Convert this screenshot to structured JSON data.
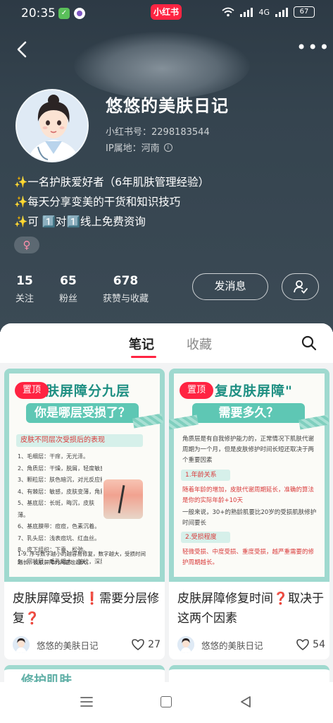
{
  "status_bar": {
    "time": "20:35",
    "app_badge": "小红书",
    "network": "4G",
    "battery": "67"
  },
  "profile": {
    "nickname": "悠悠的美肤日记",
    "id_label": "小红书号：2298183544",
    "ip_label": "IP属地：河南",
    "bio": [
      "✨一名护肤爱好者（6年肌肤管理经验）",
      "✨每天分享变美的干货和知识技巧",
      "✨可 1️⃣对1️⃣线上免费资询"
    ],
    "gender": "♀"
  },
  "stats": [
    {
      "num": "15",
      "label": "关注"
    },
    {
      "num": "65",
      "label": "粉丝"
    },
    {
      "num": "678",
      "label": "获赞与收藏"
    }
  ],
  "actions": {
    "message": "发消息"
  },
  "tabs": {
    "notes": "笔记",
    "collections": "收藏"
  },
  "cards": [
    {
      "pin": "置顶",
      "cover_title": "肤屏障分九层",
      "cover_banner": "你是哪层受损了？",
      "cover_sub": "皮肤不同层次受损后的表现",
      "cover_list": [
        "1、毛细层：干痒，无光泽。",
        "2、角质层：干燥，脱屑，轻度敏感，有紧绷感。",
        "3、颗粒层：肤色暗沉，对光反应能力下降。",
        "4、有棘层：敏感，皮肤变薄，角质层变薄。",
        "5、基底层：长斑，晦沉，皮肤薄。",
        "6、基底膜带：痘痘，色素沉着。",
        "7、乳头层：浅表痘坑、红血丝。",
        "8、皮下组织：下垂、松弛。",
        "9、网状层：毛孔粗大，皱纹，深层痘坑。"
      ],
      "cover_foot": "1-9. 序号数字越小的越容易修复，数字越大，受损时间越长，皮肤屏障的问题也越大。",
      "title": "皮肤屏障受损❗需要分层修复❓",
      "author": "悠悠的美肤日记",
      "likes": "27"
    },
    {
      "pin": "置顶",
      "cover_title": "复皮肤屏障\"",
      "cover_banner": "需要多久？",
      "cover_para": "角质层是有自我修护能力的，正常情况下肌肤代谢周期为一个月，但是皮肤修护时间长短还取决于两个重要因素",
      "tag1": "1.年龄关系",
      "red1": "随着年龄的增加，皮肤代谢周期延长，准确的算法是你的实际年龄+10天",
      "black1": "一般来说，30+的熟龄肌要比20岁的受损肌肤修护时间要长",
      "tag2": "2.受损程度",
      "red2": "轻微受损、中度受损、重度受损，越严重需要的修护周期越长。",
      "title": "皮肤屏障修复时间❓取决于这两个因素",
      "author": "悠悠的美肤日记",
      "likes": "54"
    }
  ],
  "peek": {
    "left": "修护肌肤"
  }
}
